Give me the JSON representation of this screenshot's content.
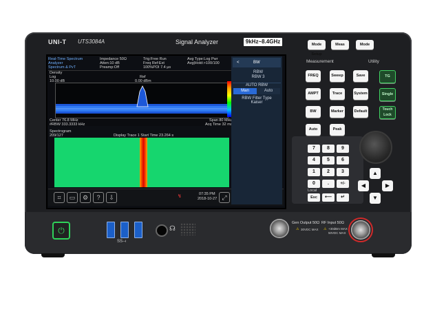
{
  "device": {
    "brand": "UNI-T",
    "model": "UTS3084A",
    "title": "Signal Analyzer",
    "range": "9kHz~8.4GHz"
  },
  "screen": {
    "mode_title_l1": "Real-Time Spectrum",
    "mode_title_l2": "Analyzer",
    "mode_title_l3": "Spectrum & PvT",
    "meas_l1": "Impedance 50Ω",
    "meas_l2": "Atten:10 dB",
    "meas_l3": "Preamp:Off",
    "trig_l1": "Trig:Free Run",
    "trig_l2": "Freq Ref:Ext",
    "trig_l3": "100%POI 7.4 μs",
    "avg_l1": "Avg Type:Log Pwr",
    "avg_l2": "Avg|Hold:>100/100",
    "density_label": "Density",
    "scale_label": "Log",
    "ref_value": "10.00 dB",
    "ref_label": "Ref",
    "ref_level": "0.00 dBm",
    "center_l1": "Center 76.8 MHz",
    "center_l2": "#RBW 333.3333 kHz",
    "span_l1": "Span 80 MHz",
    "span_l2": "Acq Time 32 ms",
    "spectrogram_title": "Spectrogram",
    "spectrogram_sub": "209/127",
    "display_trace": "Display Trace 1  Start Time 23.264 s",
    "time_value": "07:35 PM",
    "date_value": "2018-10-27",
    "bottom_icons": [
      "measure-icon",
      "folder-icon",
      "settings-icon",
      "help-icon",
      "save-icon"
    ]
  },
  "menu": {
    "back": "<",
    "header": "BW",
    "rbw_label": "RBW",
    "rbw_value": "RBW  3",
    "auto_rbw": "AUTO RBW",
    "man": "Man",
    "auto": "Auto",
    "filter_l1": "RBW Filter Type",
    "filter_l2": "Kaiser"
  },
  "keys_top": [
    "Mode Setup",
    "Meas",
    "Mode"
  ],
  "panel_titles": {
    "measurement": "Measurement",
    "utility": "Utility"
  },
  "meas_keys": [
    [
      "FREQ",
      "Sweep",
      "Save"
    ],
    [
      "AMPT",
      "Trace",
      "System"
    ],
    [
      "BW",
      "Marker",
      "Default"
    ],
    [
      "Auto",
      "Peak",
      ""
    ]
  ],
  "utility_keys": [
    "TG",
    "Single",
    "Touch Lock"
  ],
  "numpad": [
    "7",
    "8",
    "9",
    "4",
    "5",
    "6",
    "1",
    "2",
    "3",
    "0",
    ".",
    "+/-"
  ],
  "local_label": "Local",
  "esc_label": "Esc",
  "ports": {
    "gen_output_l1": "Gen Output 50Ω",
    "gen_output_l2": "30VDC MAX",
    "rf_input_l1": "RF Input 50Ω",
    "rf_input_l2": "+30dBm MAX",
    "rf_input_l3": "50VDC MAX"
  },
  "colors": {
    "accent_green": "#2fd35a",
    "menu_blue": "#2a6ad6",
    "specgram_green": "#16d66e"
  }
}
